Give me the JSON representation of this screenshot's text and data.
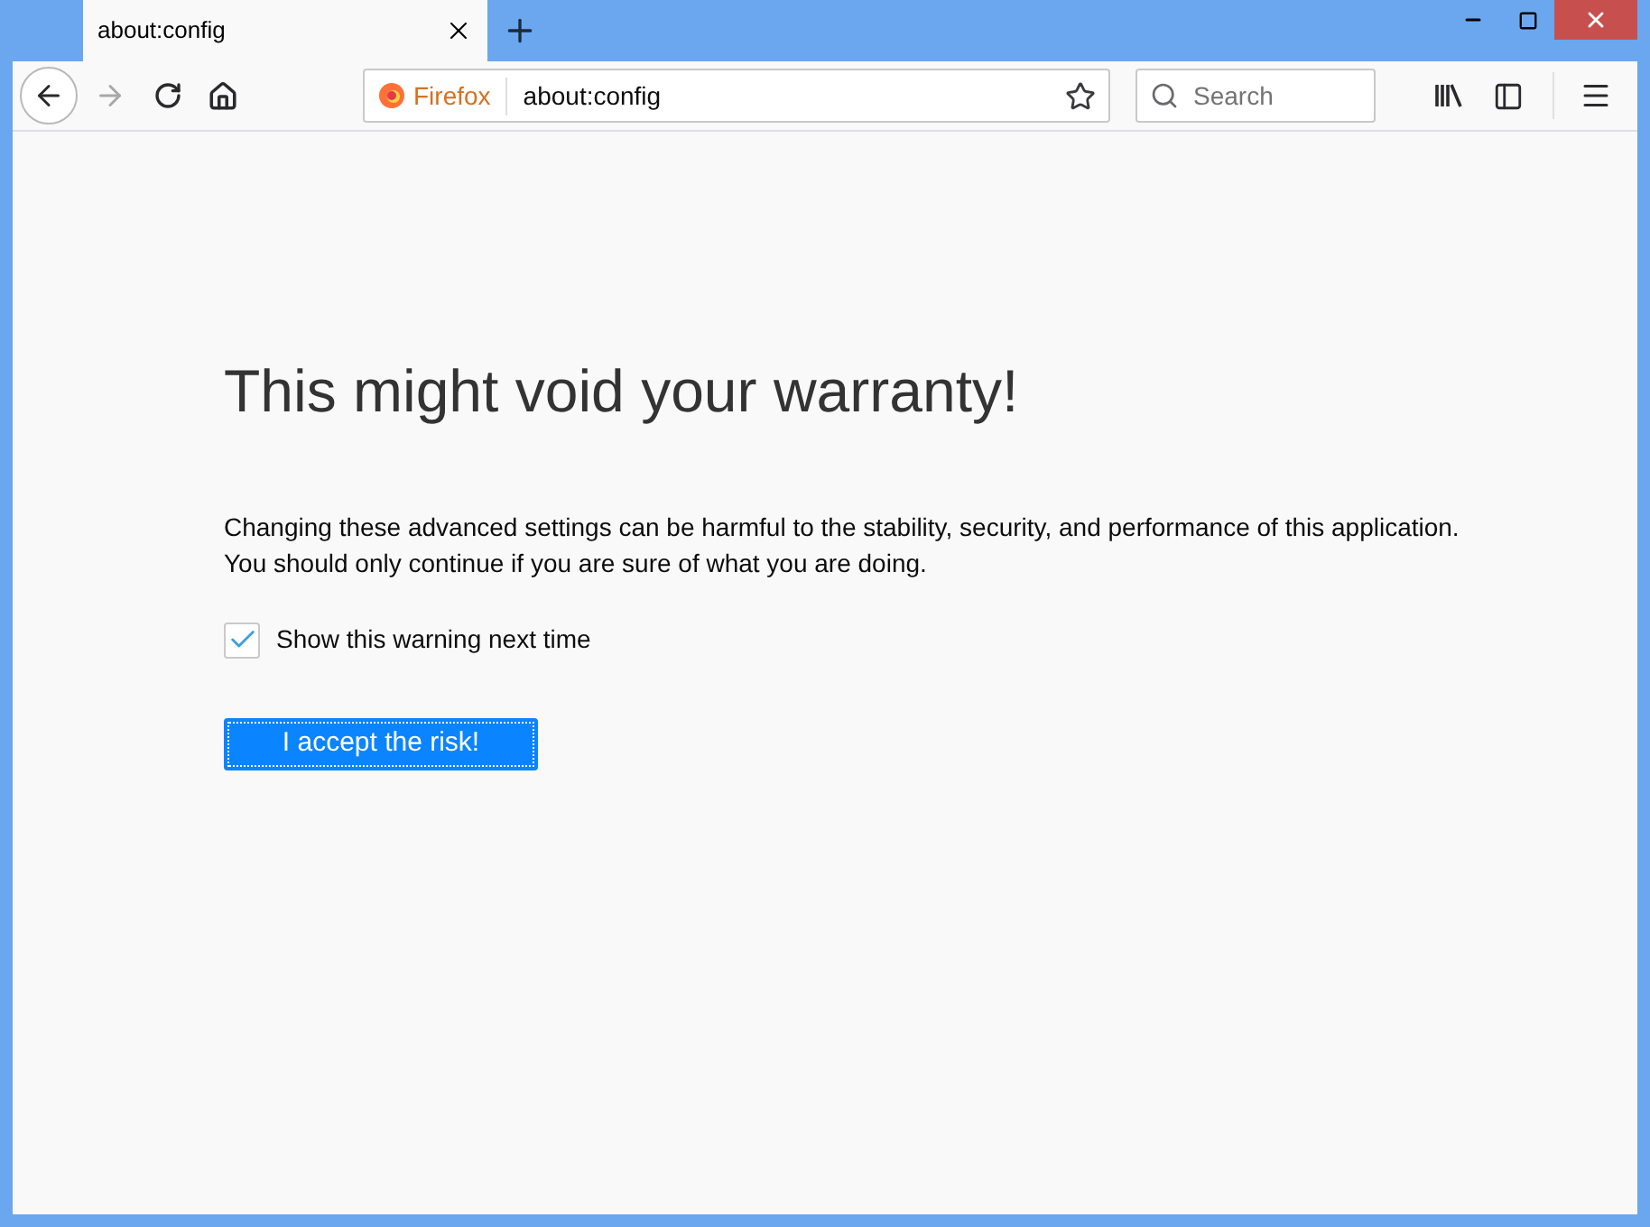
{
  "tabs": [
    {
      "title": "about:config",
      "selected": true
    }
  ],
  "nav": {
    "back_enabled": true,
    "forward_enabled": false
  },
  "url_bar": {
    "identity": "Firefox",
    "url": "about:config"
  },
  "search": {
    "placeholder": "Search"
  },
  "warning": {
    "title": "This might void your warranty!",
    "lines": [
      "Changing these advanced settings can be harmful to the stability, security, and performance of this application.",
      "You should only continue if you are sure of what you are doing."
    ],
    "checkbox": {
      "label": "Show this warning next time",
      "checked": true
    },
    "button": "I accept the risk!"
  }
}
